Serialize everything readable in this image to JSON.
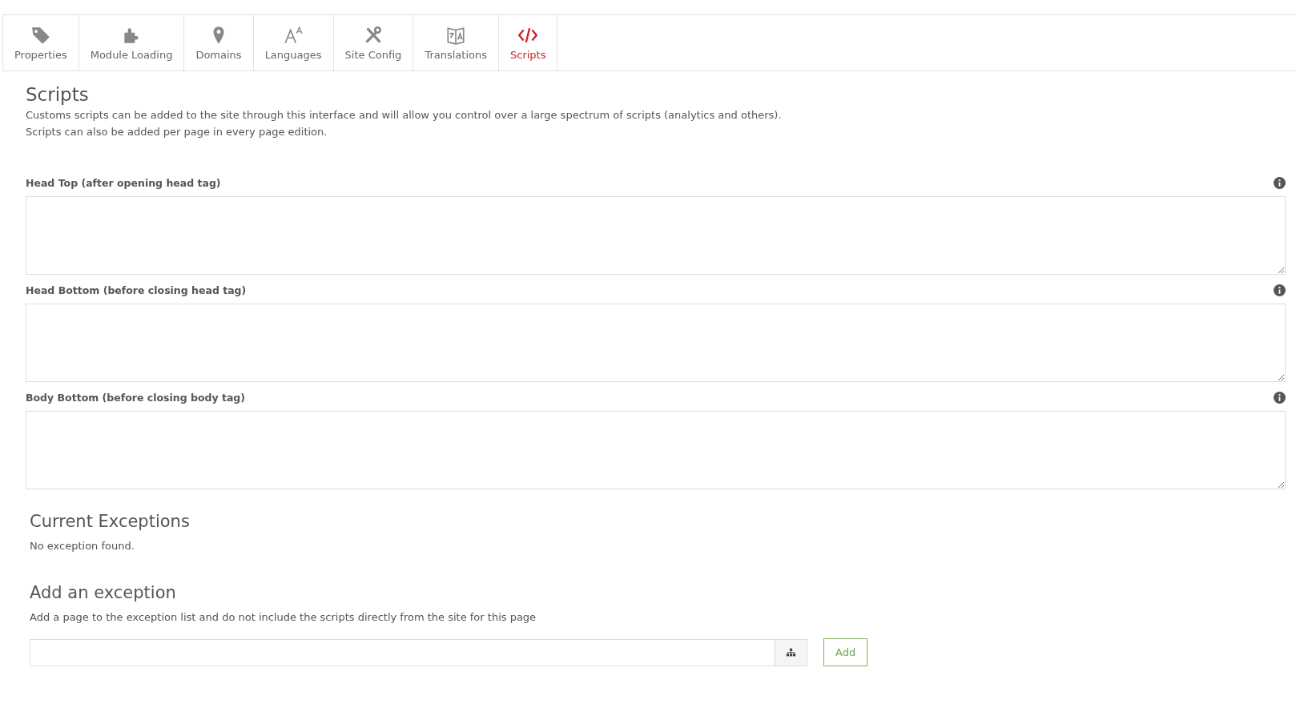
{
  "tabs": [
    {
      "label": "Properties",
      "selected": false
    },
    {
      "label": "Module Loading",
      "selected": false
    },
    {
      "label": "Domains",
      "selected": false
    },
    {
      "label": "Languages",
      "selected": false
    },
    {
      "label": "Site Config",
      "selected": false
    },
    {
      "label": "Translations",
      "selected": false
    },
    {
      "label": "Scripts",
      "selected": true
    }
  ],
  "heading": "Scripts",
  "description": [
    "Customs scripts can be added to the site through this interface and will allow you control over a large spectrum of scripts (analytics and others).",
    "Scripts can also be added per page in every page edition."
  ],
  "fields": [
    {
      "label": "Head Top (after opening head tag)"
    },
    {
      "label": "Head Bottom (before closing head tag)"
    },
    {
      "label": "Body Bottom (before closing body tag)"
    }
  ],
  "current_exceptions": {
    "title": "Current Exceptions",
    "empty_text": "No exception found."
  },
  "add_exception": {
    "title": "Add an exception",
    "description": "Add a page to the exception list and do not include the scripts directly from the site for this page",
    "button": "Add"
  }
}
